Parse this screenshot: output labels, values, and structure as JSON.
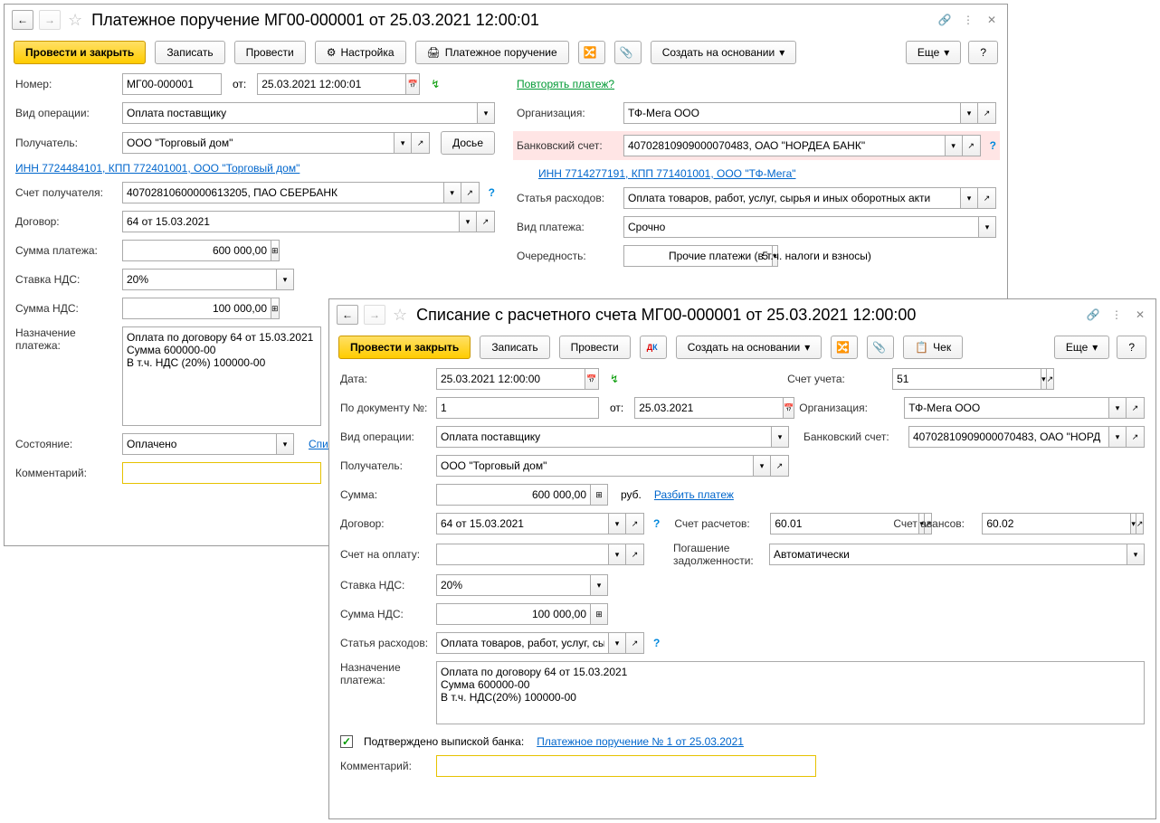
{
  "w1": {
    "title": "Платежное поручение МГ00-000001 от 25.03.2021 12:00:01",
    "btns": {
      "main": "Провести и закрыть",
      "save": "Записать",
      "post": "Провести",
      "settings": "Настройка",
      "print": "Платежное поручение",
      "create": "Создать на основании",
      "more": "Еще"
    },
    "f": {
      "number_l": "Номер:",
      "number": "МГ00-000001",
      "from": "от:",
      "date": "25.03.2021 12:00:01",
      "repeat": "Повторять платеж?",
      "optype_l": "Вид операции:",
      "optype": "Оплата поставщику",
      "org_l": "Организация:",
      "org": "ТФ-Мега ООО",
      "recip_l": "Получатель:",
      "recip": "ООО \"Торговый дом\"",
      "dossier": "Досье",
      "bank_l": "Банковский счет:",
      "bank": "40702810909000070483, ОАО \"НОРДЕА БАНК\"",
      "inn1": "ИНН 7724484101, КПП 772401001, ООО \"Торговый дом\"",
      "inn2": "ИНН 7714277191, КПП 771401001, ООО \"ТФ-Мега\"",
      "racc_l": "Счет получателя:",
      "racc": "40702810600000613205, ПАО СБЕРБАНК",
      "exp_l": "Статья расходов:",
      "exp": "Оплата товаров, работ, услуг, сырья и иных оборотных акти",
      "contract_l": "Договор:",
      "contract": "64 от 15.03.2021",
      "ptype_l": "Вид платежа:",
      "ptype": "Срочно",
      "sum_l": "Сумма платежа:",
      "sum": "600 000,00",
      "priority_l": "Очередность:",
      "priority": "5",
      "priority_txt": "Прочие платежи (в т.ч. налоги и взносы)",
      "vat_l": "Ставка НДС:",
      "vat": "20%",
      "vatsum_l": "Сумма НДС:",
      "vatsum": "100 000,00",
      "purpose_l": "Назначение платежа:",
      "purpose": "Оплата по договору 64 от 15.03.2021\nСумма 600000-00\nВ т.ч. НДС  (20%) 100000-00",
      "state_l": "Состояние:",
      "state": "Оплачено",
      "state_link": "Списа",
      "comment_l": "Комментарий:"
    }
  },
  "w2": {
    "title": "Списание с расчетного счета МГ00-000001 от 25.03.2021 12:00:00",
    "btns": {
      "main": "Провести и закрыть",
      "save": "Записать",
      "post": "Провести",
      "create": "Создать на основании",
      "check": "Чек",
      "more": "Еще"
    },
    "f": {
      "date_l": "Дата:",
      "date": "25.03.2021 12:00:00",
      "acc_l": "Счет учета:",
      "acc": "51",
      "docnum_l": "По документу №:",
      "docnum": "1",
      "from": "от:",
      "docdate": "25.03.2021",
      "org_l": "Организация:",
      "org": "ТФ-Мега ООО",
      "optype_l": "Вид операции:",
      "optype": "Оплата поставщику",
      "bank_l": "Банковский счет:",
      "bank": "40702810909000070483, ОАО \"НОРД",
      "recip_l": "Получатель:",
      "recip": "ООО \"Торговый дом\"",
      "sum_l": "Сумма:",
      "sum": "600 000,00",
      "cur": "руб.",
      "split": "Разбить платеж",
      "contract_l": "Договор:",
      "contract": "64 от 15.03.2021",
      "sacc_l": "Счет расчетов:",
      "sacc": "60.01",
      "aacc_l": "Счет авансов:",
      "aacc": "60.02",
      "inv_l": "Счет на оплату:",
      "debt_l": "Погашение задолженности:",
      "debt": "Автоматически",
      "vat_l": "Ставка НДС:",
      "vat": "20%",
      "vatsum_l": "Сумма НДС:",
      "vatsum": "100 000,00",
      "exp_l": "Статья расходов:",
      "exp": "Оплата товаров, работ, услуг, сы",
      "purpose_l": "Назначение платежа:",
      "purpose": "Оплата по договору 64 от 15.03.2021\nСумма 600000-00\nВ т.ч. НДС(20%) 100000-00",
      "confirmed": "Подтверждено выпиской банка:",
      "confirmed_link": "Платежное поручение № 1 от 25.03.2021",
      "comment_l": "Комментарий:"
    }
  }
}
